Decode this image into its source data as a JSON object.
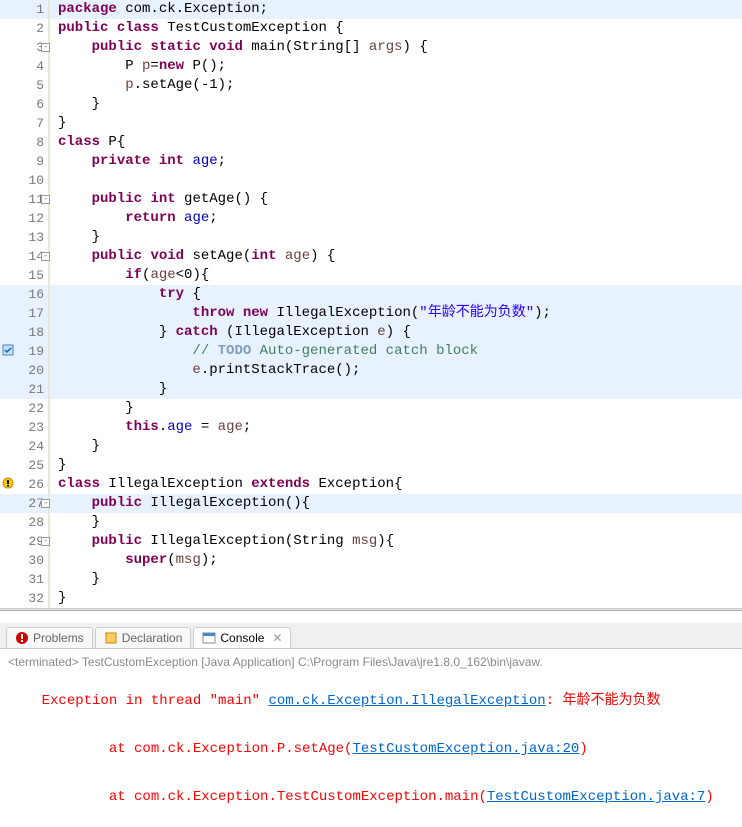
{
  "code": {
    "lines": [
      {
        "n": 1,
        "hl": true,
        "ul": true,
        "marker": "",
        "fold": "",
        "segs": [
          [
            "kw",
            "package"
          ],
          [
            "plain",
            " com.ck.Exception;"
          ]
        ]
      },
      {
        "n": 2,
        "hl": false,
        "ul": false,
        "marker": "",
        "fold": "",
        "segs": [
          [
            "kw",
            "public"
          ],
          [
            "plain",
            " "
          ],
          [
            "kw",
            "class"
          ],
          [
            "plain",
            " TestCustomException {"
          ]
        ]
      },
      {
        "n": 3,
        "hl": false,
        "ul": false,
        "marker": "",
        "fold": "⊖",
        "segs": [
          [
            "plain",
            "    "
          ],
          [
            "kw",
            "public"
          ],
          [
            "plain",
            " "
          ],
          [
            "kw",
            "static"
          ],
          [
            "plain",
            " "
          ],
          [
            "kw",
            "void"
          ],
          [
            "plain",
            " main(String[] "
          ],
          [
            "param",
            "args"
          ],
          [
            "plain",
            ") {"
          ]
        ]
      },
      {
        "n": 4,
        "hl": false,
        "ul": false,
        "marker": "",
        "fold": "",
        "segs": [
          [
            "plain",
            "        P "
          ],
          [
            "param",
            "p"
          ],
          [
            "plain",
            "="
          ],
          [
            "kw",
            "new"
          ],
          [
            "plain",
            " P();"
          ]
        ]
      },
      {
        "n": 5,
        "hl": false,
        "ul": false,
        "marker": "",
        "fold": "",
        "segs": [
          [
            "plain",
            "        "
          ],
          [
            "param",
            "p"
          ],
          [
            "plain",
            ".setAge(-1);"
          ]
        ]
      },
      {
        "n": 6,
        "hl": false,
        "ul": false,
        "marker": "",
        "fold": "",
        "segs": [
          [
            "plain",
            "    }"
          ]
        ]
      },
      {
        "n": 7,
        "hl": false,
        "ul": true,
        "marker": "",
        "fold": "",
        "segs": [
          [
            "plain",
            "}"
          ]
        ]
      },
      {
        "n": 8,
        "hl": false,
        "ul": false,
        "marker": "",
        "fold": "",
        "segs": [
          [
            "kw",
            "class"
          ],
          [
            "plain",
            " P{"
          ]
        ]
      },
      {
        "n": 9,
        "hl": false,
        "ul": false,
        "marker": "",
        "fold": "",
        "segs": [
          [
            "plain",
            "    "
          ],
          [
            "kw",
            "private"
          ],
          [
            "plain",
            " "
          ],
          [
            "kw",
            "int"
          ],
          [
            "plain",
            " "
          ],
          [
            "field",
            "age"
          ],
          [
            "plain",
            ";"
          ]
        ]
      },
      {
        "n": 10,
        "hl": false,
        "ul": false,
        "marker": "",
        "fold": "",
        "segs": [
          [
            "plain",
            ""
          ]
        ]
      },
      {
        "n": 11,
        "hl": false,
        "ul": false,
        "marker": "",
        "fold": "⊖",
        "segs": [
          [
            "plain",
            "    "
          ],
          [
            "kw",
            "public"
          ],
          [
            "plain",
            " "
          ],
          [
            "kw",
            "int"
          ],
          [
            "plain",
            " getAge() {"
          ]
        ]
      },
      {
        "n": 12,
        "hl": false,
        "ul": false,
        "marker": "",
        "fold": "",
        "segs": [
          [
            "plain",
            "        "
          ],
          [
            "kw",
            "return"
          ],
          [
            "plain",
            " "
          ],
          [
            "field",
            "age"
          ],
          [
            "plain",
            ";"
          ]
        ]
      },
      {
        "n": 13,
        "hl": false,
        "ul": true,
        "marker": "",
        "fold": "",
        "segs": [
          [
            "plain",
            "    }"
          ]
        ]
      },
      {
        "n": 14,
        "hl": false,
        "ul": true,
        "marker": "",
        "fold": "⊖",
        "segs": [
          [
            "plain",
            "    "
          ],
          [
            "kw",
            "public"
          ],
          [
            "plain",
            " "
          ],
          [
            "kw",
            "void"
          ],
          [
            "plain",
            " setAge("
          ],
          [
            "kw",
            "int"
          ],
          [
            "plain",
            " "
          ],
          [
            "param",
            "age"
          ],
          [
            "plain",
            ") {"
          ]
        ]
      },
      {
        "n": 15,
        "hl": false,
        "ul": false,
        "marker": "",
        "fold": "",
        "segs": [
          [
            "plain",
            "        "
          ],
          [
            "kw",
            "if"
          ],
          [
            "plain",
            "("
          ],
          [
            "param",
            "age"
          ],
          [
            "plain",
            "<0){"
          ]
        ]
      },
      {
        "n": 16,
        "hl": true,
        "ul": false,
        "marker": "",
        "fold": "",
        "segs": [
          [
            "plain",
            "            "
          ],
          [
            "kw",
            "try"
          ],
          [
            "plain",
            " {"
          ]
        ]
      },
      {
        "n": 17,
        "hl": true,
        "ul": false,
        "marker": "",
        "fold": "",
        "segs": [
          [
            "plain",
            "                "
          ],
          [
            "kw",
            "throw"
          ],
          [
            "plain",
            " "
          ],
          [
            "kw",
            "new"
          ],
          [
            "plain",
            " IllegalException("
          ],
          [
            "str",
            "\"年龄不能为负数\""
          ],
          [
            "plain",
            ");"
          ]
        ]
      },
      {
        "n": 18,
        "hl": true,
        "ul": false,
        "marker": "",
        "fold": "",
        "segs": [
          [
            "plain",
            "            } "
          ],
          [
            "kw",
            "catch"
          ],
          [
            "plain",
            " (IllegalException "
          ],
          [
            "param",
            "e"
          ],
          [
            "plain",
            ") {"
          ]
        ]
      },
      {
        "n": 19,
        "hl": true,
        "ul": false,
        "marker": "task",
        "fold": "",
        "segs": [
          [
            "plain",
            "                "
          ],
          [
            "com",
            "// "
          ],
          [
            "todo",
            "TODO"
          ],
          [
            "com",
            " Auto-generated catch block"
          ]
        ]
      },
      {
        "n": 20,
        "hl": true,
        "ul": false,
        "marker": "",
        "fold": "",
        "segs": [
          [
            "plain",
            "                "
          ],
          [
            "param",
            "e"
          ],
          [
            "plain",
            ".printStackTrace();"
          ]
        ]
      },
      {
        "n": 21,
        "hl": true,
        "ul": true,
        "marker": "",
        "fold": "",
        "segs": [
          [
            "plain",
            "            }"
          ]
        ]
      },
      {
        "n": 22,
        "hl": false,
        "ul": false,
        "marker": "",
        "fold": "",
        "segs": [
          [
            "plain",
            "        }"
          ]
        ]
      },
      {
        "n": 23,
        "hl": false,
        "ul": false,
        "marker": "",
        "fold": "",
        "segs": [
          [
            "plain",
            "        "
          ],
          [
            "kw",
            "this"
          ],
          [
            "plain",
            "."
          ],
          [
            "field",
            "age"
          ],
          [
            "plain",
            " = "
          ],
          [
            "param",
            "age"
          ],
          [
            "plain",
            ";"
          ]
        ]
      },
      {
        "n": 24,
        "hl": false,
        "ul": false,
        "marker": "",
        "fold": "",
        "segs": [
          [
            "plain",
            "    }"
          ]
        ]
      },
      {
        "n": 25,
        "hl": false,
        "ul": false,
        "marker": "",
        "fold": "",
        "segs": [
          [
            "plain",
            "}"
          ]
        ]
      },
      {
        "n": 26,
        "hl": false,
        "ul": false,
        "marker": "warn",
        "fold": "",
        "segs": [
          [
            "kw",
            "class"
          ],
          [
            "plain",
            " IllegalException "
          ],
          [
            "kw",
            "extends"
          ],
          [
            "plain",
            " Exception{"
          ]
        ]
      },
      {
        "n": 27,
        "hl": true,
        "ul": true,
        "marker": "",
        "fold": "⊖",
        "segs": [
          [
            "plain",
            "    "
          ],
          [
            "kw",
            "public"
          ],
          [
            "plain",
            " IllegalException(){"
          ]
        ]
      },
      {
        "n": 28,
        "hl": false,
        "ul": false,
        "marker": "",
        "fold": "",
        "segs": [
          [
            "plain",
            "    }"
          ]
        ]
      },
      {
        "n": 29,
        "hl": false,
        "ul": false,
        "marker": "",
        "fold": "⊖",
        "segs": [
          [
            "plain",
            "    "
          ],
          [
            "kw",
            "public"
          ],
          [
            "plain",
            " IllegalException(String "
          ],
          [
            "param",
            "msg"
          ],
          [
            "plain",
            "){"
          ]
        ]
      },
      {
        "n": 30,
        "hl": false,
        "ul": false,
        "marker": "",
        "fold": "",
        "segs": [
          [
            "plain",
            "        "
          ],
          [
            "kw",
            "super"
          ],
          [
            "plain",
            "("
          ],
          [
            "param",
            "msg"
          ],
          [
            "plain",
            ");"
          ]
        ]
      },
      {
        "n": 31,
        "hl": false,
        "ul": false,
        "marker": "",
        "fold": "",
        "segs": [
          [
            "plain",
            "    }"
          ]
        ]
      },
      {
        "n": 32,
        "hl": false,
        "ul": false,
        "marker": "",
        "fold": "",
        "segs": [
          [
            "plain",
            "}"
          ]
        ]
      }
    ]
  },
  "tabs": {
    "problems": "Problems",
    "declaration": "Declaration",
    "console": "Console"
  },
  "console": {
    "terminated": "<terminated> TestCustomException [Java Application] C:\\Program Files\\Java\\jre1.8.0_162\\bin\\javaw.",
    "line1_a": "Exception in thread \"main\" ",
    "line1_link": "com.ck.Exception.IllegalException",
    "line1_b": ": 年龄不能为负数",
    "line2_a": "        at com.ck.Exception.P.setAge(",
    "line2_link": "TestCustomException.java:20",
    "line2_b": ")",
    "line3_a": "        at com.ck.Exception.TestCustomException.main(",
    "line3_link": "TestCustomException.java:7",
    "line3_b": ")"
  }
}
